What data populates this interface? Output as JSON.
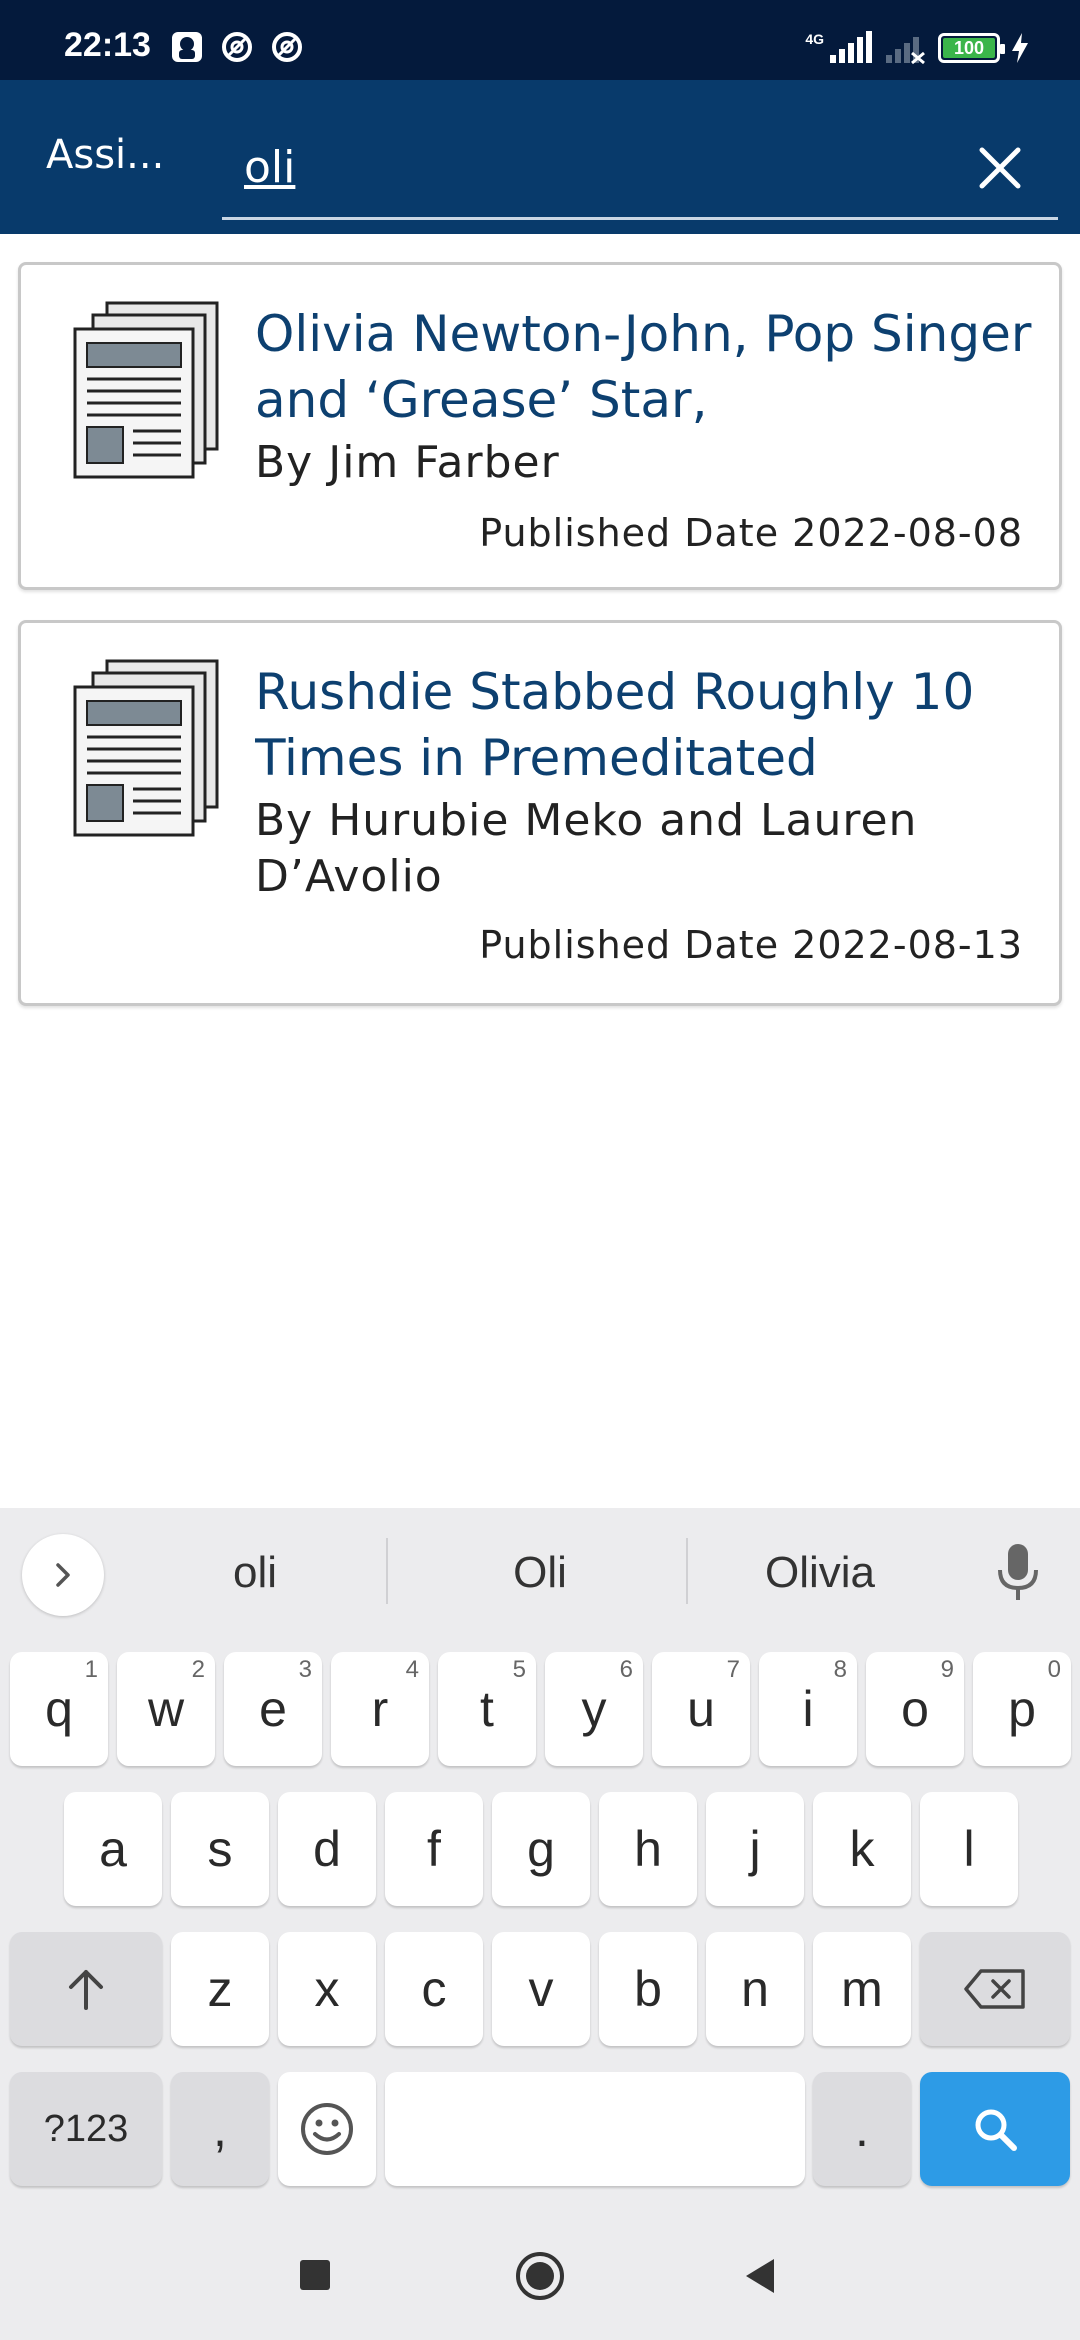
{
  "status_bar": {
    "time": "22:13",
    "network": "4G",
    "battery": "100",
    "icons": [
      "app-badge-icon",
      "no-disturb-icon",
      "no-disturb-icon",
      "signal-icon",
      "signal-none-icon",
      "battery-icon",
      "charging-icon"
    ]
  },
  "app_bar": {
    "title": "Assi...",
    "search_value": "oli"
  },
  "results": [
    {
      "title": "Olivia Newton-John, Pop Singer and ‘Grease’ Star,",
      "author": "By Jim Farber",
      "date": "Published Date 2022-08-08",
      "icon": "newspaper-icon"
    },
    {
      "title": "Rushdie Stabbed Roughly 10 Times in Premeditated",
      "author": "By Hurubie Meko and Lauren D’Avolio",
      "date": "Published Date 2022-08-13",
      "icon": "newspaper-icon"
    }
  ],
  "keyboard": {
    "suggestions": [
      "oli",
      "Oli",
      "Olivia"
    ],
    "row1": [
      "q",
      "w",
      "e",
      "r",
      "t",
      "y",
      "u",
      "i",
      "o",
      "p"
    ],
    "row1_hints": [
      "1",
      "2",
      "3",
      "4",
      "5",
      "6",
      "7",
      "8",
      "9",
      "0"
    ],
    "row2": [
      "a",
      "s",
      "d",
      "f",
      "g",
      "h",
      "j",
      "k",
      "l"
    ],
    "row3": [
      "z",
      "x",
      "c",
      "v",
      "b",
      "n",
      "m"
    ],
    "symbols_label": "?123",
    "comma": ",",
    "period": "."
  },
  "colors": {
    "status_bar": "#041a3c",
    "app_bar": "#083a6b",
    "title_text": "#0d4070",
    "search_key": "#2d9be6"
  }
}
